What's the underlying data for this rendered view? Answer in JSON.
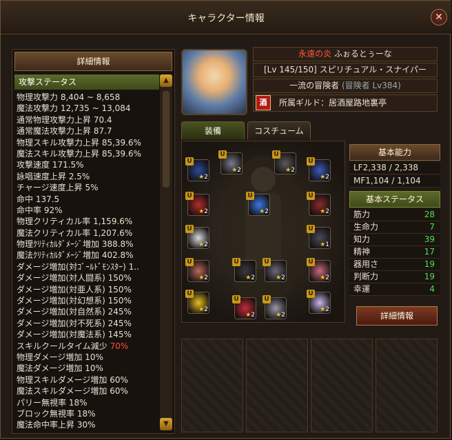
{
  "window": {
    "title": "キャラクター情報",
    "close_symbol": "✕"
  },
  "left_panel": {
    "header": "詳細情報",
    "section": "攻撃ステータス",
    "scroll_up": "▲",
    "scroll_down": "▼",
    "stats": [
      "物理攻撃力 8,404 ~ 8,658",
      "魔法攻撃力 12,735 ~ 13,084",
      "通常物理攻撃力上昇 70.4",
      "通常魔法攻撃力上昇 87.7",
      "物理スキル攻撃力上昇 85,39.6%",
      "魔法スキル攻撃力上昇 85,39.6%",
      "攻撃速度 171.5%",
      "詠唱速度上昇 2.5%",
      "チャージ速度上昇 5%",
      "命中 137.5",
      "命中率 92%",
      "物理クリティカル率 1,159.6%",
      "魔法クリティカル率 1,207.6%",
      "物理ｸﾘﾃｨｶﾙﾀﾞﾒｰｼﾞ増加 388.8%",
      "魔法ｸﾘﾃｨｶﾙﾀﾞﾒｰｼﾞ増加 402.8%",
      "ダメージ増加(対ｺﾞｰﾙﾄﾞﾓﾝｽﾀｰ) 1..",
      "ダメージ増加(対人闘系) 150%",
      "ダメージ増加(対亜人系) 150%",
      "ダメージ増加(対幻想系) 150%",
      "ダメージ増加(対自然系) 245%",
      "ダメージ増加(対不死系) 245%",
      "ダメージ増加(対魔法系) 145%",
      "スキルクールタイム減少 ",
      "物理ダメージ増加 10%",
      "魔法ダメージ増加 10%",
      "物理スキルダメージ増加 60%",
      "魔法スキルダメージ増加 60%",
      "パリー無視率 18%",
      "ブロック無視率 18%",
      "魔法命中率上昇 30%"
    ],
    "cooltime_value": "70%"
  },
  "profile": {
    "epithet": "永遠の炎",
    "name": "ふぉるとぅーな",
    "level_class": "[Lv 145/150] スピリチュアル・スナイパー",
    "adventurer_title": "一流の冒険者",
    "adventurer_level": "(冒険者 Lv384)",
    "guild_icon": "酒",
    "guild_text": "所属ギルド：居酒屋路地裏亭"
  },
  "tabs": [
    "装備",
    "コスチューム"
  ],
  "equipment": {
    "lock_letter": "U",
    "slot_level": "2",
    "slot_level_alt": "1",
    "star": "★",
    "slots": [
      {
        "icon": "hat-icon",
        "color": "#2a4a9a"
      },
      {
        "icon": "weapon-icon",
        "color": "#7a7a8a"
      },
      {
        "icon": "wing-icon",
        "color": "#5a5a5a"
      },
      {
        "icon": "coat-icon",
        "color": "#3a5ab8"
      },
      {
        "icon": "robe-icon",
        "color": "#b82a2a"
      },
      {
        "icon": "necklace-icon",
        "color": "#3a7ae8"
      },
      {
        "icon": "cloak-icon",
        "color": "#8a2a2a"
      },
      {
        "icon": "shoulder-icon",
        "color": "#d8d8e0"
      },
      {
        "icon": "belt-icon",
        "color": "#4a4a5a"
      },
      {
        "icon": "glove-icon",
        "color": "#b86a5a"
      },
      {
        "icon": "ring-icon",
        "color": "#3a3a3a"
      },
      {
        "icon": "ring-icon",
        "color": "#6a6a7a"
      },
      {
        "icon": "earring-icon",
        "color": "#c86a7a"
      },
      {
        "icon": "boots-icon",
        "color": "#e8c020"
      },
      {
        "icon": "jewel-ring-icon",
        "color": "#c82a3a"
      },
      {
        "icon": "bracelet-icon",
        "color": "#9a9aa8"
      },
      {
        "icon": "star-charm-icon",
        "color": "#c8b8e8"
      }
    ]
  },
  "basic_ability": {
    "header": "基本能力",
    "lf": "LF2,338 / 2,338",
    "mf": "MF1,104 / 1,104"
  },
  "basic_status": {
    "header": "基本ステータス",
    "rows": [
      {
        "label": "筋力",
        "value": "28"
      },
      {
        "label": "生命力",
        "value": "7"
      },
      {
        "label": "知力",
        "value": "39"
      },
      {
        "label": "精神",
        "value": "17"
      },
      {
        "label": "器用さ",
        "value": "19"
      },
      {
        "label": "判断力",
        "value": "19"
      },
      {
        "label": "幸運",
        "value": "4"
      }
    ]
  },
  "detail_button": "詳細情報"
}
